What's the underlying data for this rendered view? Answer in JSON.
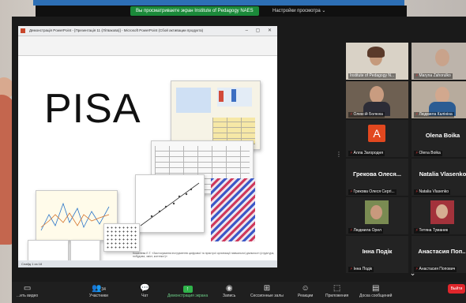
{
  "banner": {
    "viewing_text": "Вы просматриваете экран Institute of Pedagogy NAES",
    "view_options": "Настройки просмотра ⌄"
  },
  "ppt": {
    "title": "Демонстрація PowerPoint - [Презентація 11 (Літвакова)] - Microsoft PowerPoint (Сбой активации продукта)",
    "window_buttons": "– ▢ ✕",
    "slide_title": "PISA",
    "slide_caption": "Кошелева Е.Т. «Застосування інструментів цифрової та пристрої організації навчальної діяльності (структура, побудова, зміст, контекст)»",
    "status": "Слайд 1 из 18"
  },
  "participants": [
    {
      "name": "Institute of Pedagogy N...",
      "muted": false,
      "video": true,
      "highlight": true
    },
    {
      "name": "Maryna Zahorulko",
      "muted": true,
      "video": true,
      "highlight": false
    },
    {
      "name": "Олексій Болюха",
      "muted": true,
      "video": true,
      "highlight": false
    },
    {
      "name": "Людмила Калініна",
      "muted": true,
      "video": true,
      "highlight": false
    },
    {
      "name": "Алла Загородня",
      "muted": true,
      "video": false,
      "avatar": "A",
      "highlight": false
    },
    {
      "name": "Olena Boika",
      "muted": true,
      "video": false,
      "display": "Olena Boika",
      "highlight": false
    },
    {
      "name": "Грекова Олеся Сергі...",
      "muted": true,
      "video": false,
      "display": "Грекова Олеся...",
      "highlight": false
    },
    {
      "name": "Natalia Vlasenko",
      "muted": true,
      "video": false,
      "display": "Natalia Vlasenko",
      "highlight": false
    },
    {
      "name": "Людмила Орел",
      "muted": true,
      "video": true,
      "highlight": false
    },
    {
      "name": "Тетяна Туманик",
      "muted": true,
      "video": true,
      "highlight": false
    },
    {
      "name": "Інна Подік",
      "muted": true,
      "video": false,
      "display": "Інна Подік",
      "highlight": false
    },
    {
      "name": "Анастасия Попович",
      "muted": true,
      "video": false,
      "display": "Анастасия Поп...",
      "highlight": false
    }
  ],
  "toolbar": {
    "video": "...ить видео",
    "participants": "Участники",
    "participants_count": "34",
    "chat": "Чат",
    "share": "Демонстрация экрана",
    "record": "Запись",
    "breakout": "Сессионные залы",
    "reactions": "Реакции",
    "apps": "Приложения",
    "whiteboard": "Доска сообщений",
    "end": "Выйти"
  },
  "colors": {
    "share_green": "#2fb34a",
    "mute_red": "#e03a3a",
    "end_red": "#e0262b",
    "highlight": "#b9d73a"
  }
}
